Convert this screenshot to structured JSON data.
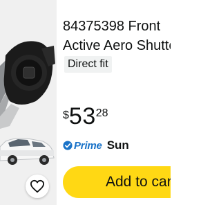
{
  "product": {
    "title_line1": "84375398 Front",
    "title_line2": "Active Aero Shutter",
    "badge": "Direct fit",
    "price": {
      "symbol": "$",
      "whole": "53",
      "fraction": "28"
    },
    "prime_label": "Prime",
    "delivery_day": "Sun",
    "add_to_cart_label": "Add to cart"
  },
  "icons": {
    "wishlist": "heart-outline-icon",
    "prime": "prime-check-icon"
  },
  "colors": {
    "button": "#ffd814",
    "prime": "#1a73c8",
    "image_bg": "#f0f0f0"
  }
}
